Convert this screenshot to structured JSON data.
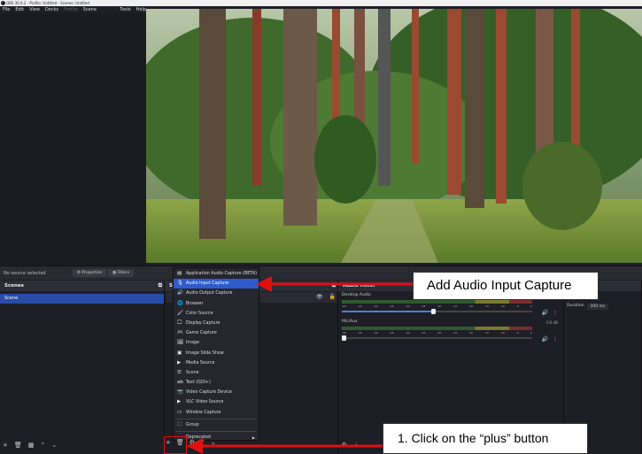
{
  "window": {
    "title": "OBS 30.0.2 - Profile: Untitled - Scenes: Untitled"
  },
  "menu": [
    {
      "label": "File",
      "dim": false
    },
    {
      "label": "Edit",
      "dim": false
    },
    {
      "label": "View",
      "dim": false
    },
    {
      "label": "Docks",
      "dim": false
    },
    {
      "label": "Profile",
      "dim": true
    },
    {
      "label": "Scene Collection",
      "dim": false
    },
    {
      "label": "Tools",
      "dim": false
    },
    {
      "label": "Help",
      "dim": false
    }
  ],
  "source_bar": {
    "no_selection": "No source selected",
    "properties": "Properties",
    "filters": "Filters"
  },
  "scenes": {
    "title": "Scenes",
    "items": [
      "Scene"
    ]
  },
  "sources": {
    "title": "S"
  },
  "context_menu": {
    "items": [
      {
        "label": "Application Audio Capture (BETA)",
        "icon": "app-audio-icon",
        "glyph": "▤"
      },
      {
        "label": "Audio Input Capture",
        "icon": "microphone-icon",
        "glyph": "🎙",
        "highlight": true
      },
      {
        "label": "Audio Output Capture",
        "icon": "speaker-icon",
        "glyph": "🔊"
      },
      {
        "label": "Browser",
        "icon": "globe-icon",
        "glyph": "🌐"
      },
      {
        "label": "Color Source",
        "icon": "brush-icon",
        "glyph": "🖌"
      },
      {
        "label": "Display Capture",
        "icon": "monitor-icon",
        "glyph": "🖵"
      },
      {
        "label": "Game Capture",
        "icon": "gamepad-icon",
        "glyph": "🎮"
      },
      {
        "label": "Image",
        "icon": "image-icon",
        "glyph": "🖼"
      },
      {
        "label": "Image Slide Show",
        "icon": "slideshow-icon",
        "glyph": "▣"
      },
      {
        "label": "Media Source",
        "icon": "play-icon",
        "glyph": "▶"
      },
      {
        "label": "Scene",
        "icon": "list-icon",
        "glyph": "☰"
      },
      {
        "label": "Text (GDI+)",
        "icon": "text-icon",
        "glyph": "ab"
      },
      {
        "label": "Video Capture Device",
        "icon": "camera-icon",
        "glyph": "📷"
      },
      {
        "label": "VLC Video Source",
        "icon": "vlc-icon",
        "glyph": "▶"
      },
      {
        "label": "Window Capture",
        "icon": "window-icon",
        "glyph": "▭"
      }
    ],
    "group": "Group",
    "deprecated": "Deprecated"
  },
  "mixer": {
    "title": "Audio Mixer",
    "scale": [
      "-60",
      "-55",
      "-50",
      "-45",
      "-40",
      "-35",
      "-30",
      "-25",
      "-20",
      "-15",
      "-10",
      "-5",
      "0"
    ],
    "channels": [
      {
        "name": "Desktop Audio",
        "db": "",
        "level": 0.48
      },
      {
        "name": "Mic/Aux",
        "db": "0.0 dB",
        "level": 0.01
      }
    ]
  },
  "transitions": {
    "title": "ions",
    "duration_label": "Duration",
    "duration_value": "300 ms"
  },
  "callouts": {
    "audio": "Add Audio Input Capture",
    "plus": "1. Click on the “plus” button"
  },
  "colors": {
    "highlight": "#2f5bcc",
    "annotation": "#e01010"
  }
}
